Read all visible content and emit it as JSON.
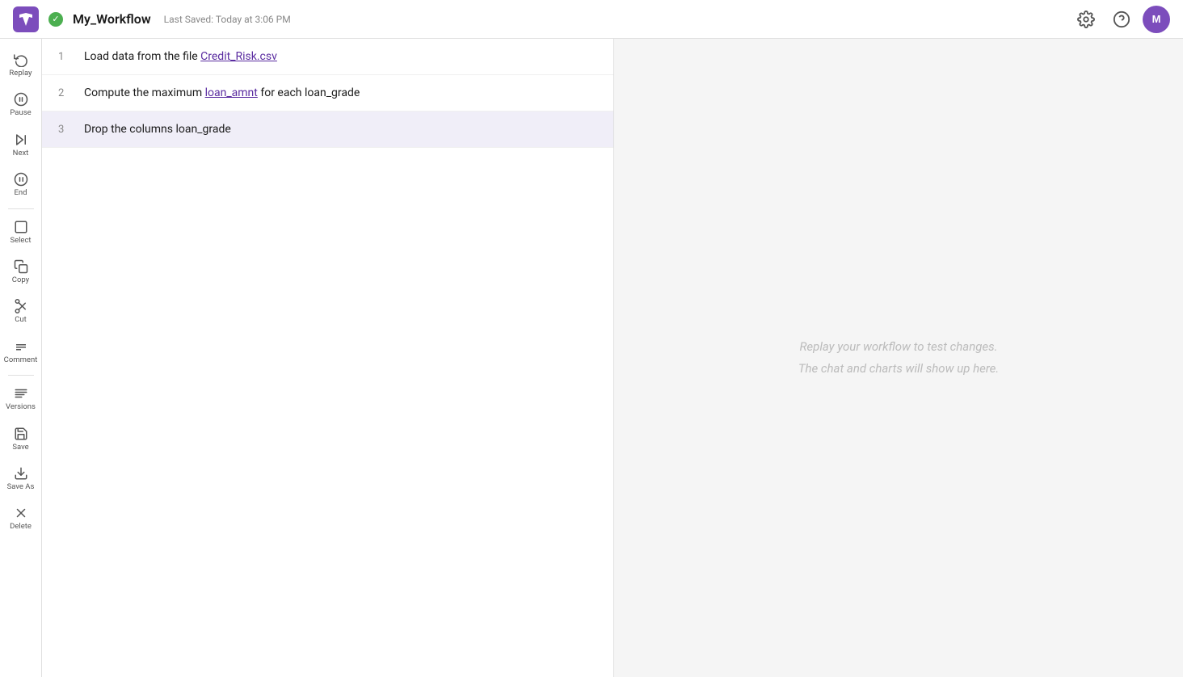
{
  "header": {
    "logo_alt": "App Logo",
    "status": "saved",
    "title": "My_Workflow",
    "last_saved": "Last Saved: Today at 3:06 PM",
    "settings_label": "Settings",
    "help_label": "Help",
    "avatar_label": "M"
  },
  "sidebar": {
    "items": [
      {
        "id": "replay",
        "label": "Replay",
        "icon": "replay"
      },
      {
        "id": "pause",
        "label": "Pause",
        "icon": "pause"
      },
      {
        "id": "next",
        "label": "Next",
        "icon": "next"
      },
      {
        "id": "end",
        "label": "End",
        "icon": "end"
      },
      {
        "id": "select",
        "label": "Select",
        "icon": "select"
      },
      {
        "id": "copy",
        "label": "Copy",
        "icon": "copy"
      },
      {
        "id": "cut",
        "label": "Cut",
        "icon": "cut"
      },
      {
        "id": "comment",
        "label": "Comment",
        "icon": "comment"
      },
      {
        "id": "versions",
        "label": "Versions",
        "icon": "versions"
      },
      {
        "id": "save",
        "label": "Save",
        "icon": "save"
      },
      {
        "id": "save-as",
        "label": "Save As",
        "icon": "save-as"
      },
      {
        "id": "delete",
        "label": "Delete",
        "icon": "delete"
      }
    ]
  },
  "workflow": {
    "steps": [
      {
        "number": 1,
        "text_before": "Load data from the file ",
        "link": "Credit_Risk.csv",
        "text_after": "",
        "active": false
      },
      {
        "number": 2,
        "text_before": "Compute the maximum ",
        "link": "loan_amnt",
        "text_after": " for each loan_grade",
        "active": false
      },
      {
        "number": 3,
        "text_before": "Drop the columns loan_grade",
        "link": "",
        "text_after": "",
        "active": true
      }
    ]
  },
  "right_panel": {
    "placeholder_line1": "Replay your workflow to test changes.",
    "placeholder_line2": "The chat and charts will show up here."
  }
}
